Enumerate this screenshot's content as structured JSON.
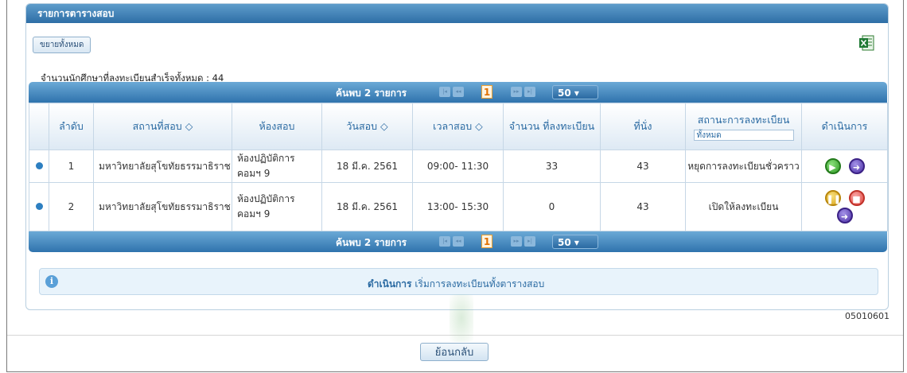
{
  "panel": {
    "title": "รายการตารางสอบ"
  },
  "toolbar": {
    "expand_all_label": "ขยายทั้งหมด"
  },
  "summary": {
    "count_text": "จำนวนนักศึกษาที่ลงทะเบียนสำเร็จทั้งหมด : 44"
  },
  "pager": {
    "found_text": "ค้นพบ 2 รายการ",
    "current_page": "1",
    "page_size": "50"
  },
  "table": {
    "headers": {
      "no": "ลำดับ",
      "place": "สถานที่สอบ ◇",
      "room": "ห้องสอบ",
      "date": "วันสอบ ◇",
      "time": "เวลาสอบ ◇",
      "registered": "จำนวน ที่ลงทะเบียน",
      "seats": "ที่นั่ง",
      "status": "สถานะการลงทะเบียน",
      "status_filter": "ทั้งหมด",
      "action": "ดำเนินการ"
    },
    "rows": [
      {
        "no": "1",
        "place": "มหาวิทยาลัยสุโขทัยธรรมาธิราช",
        "room": "ห้องปฏิบัติการ คอมฯ 9",
        "date": "18 มี.ค. 2561",
        "time": "09:00- 11:30",
        "registered": "33",
        "seats": "43",
        "status": "หยุดการลงทะเบียนชั่วคราว"
      },
      {
        "no": "2",
        "place": "มหาวิทยาลัยสุโขทัยธรรมาธิราช",
        "room": "ห้องปฏิบัติการ คอมฯ 9",
        "date": "18 มี.ค. 2561",
        "time": "13:00- 15:30",
        "registered": "0",
        "seats": "43",
        "status": "เปิดให้ลงทะเบียน"
      }
    ]
  },
  "info": {
    "label": "ดำเนินการ",
    "message": "เริ่มการลงทะเบียนทั้งตารางสอบ"
  },
  "footer": {
    "code": "05010601",
    "back_label": "ย้อนกลับ"
  },
  "colors": {
    "header_blue": "#2e6ea6",
    "link_blue": "#2a6aa2",
    "play_green": "#2f9a25",
    "next_purple": "#4b2fa5",
    "pause_yellow": "#d8a318",
    "stop_red": "#e0443c"
  }
}
